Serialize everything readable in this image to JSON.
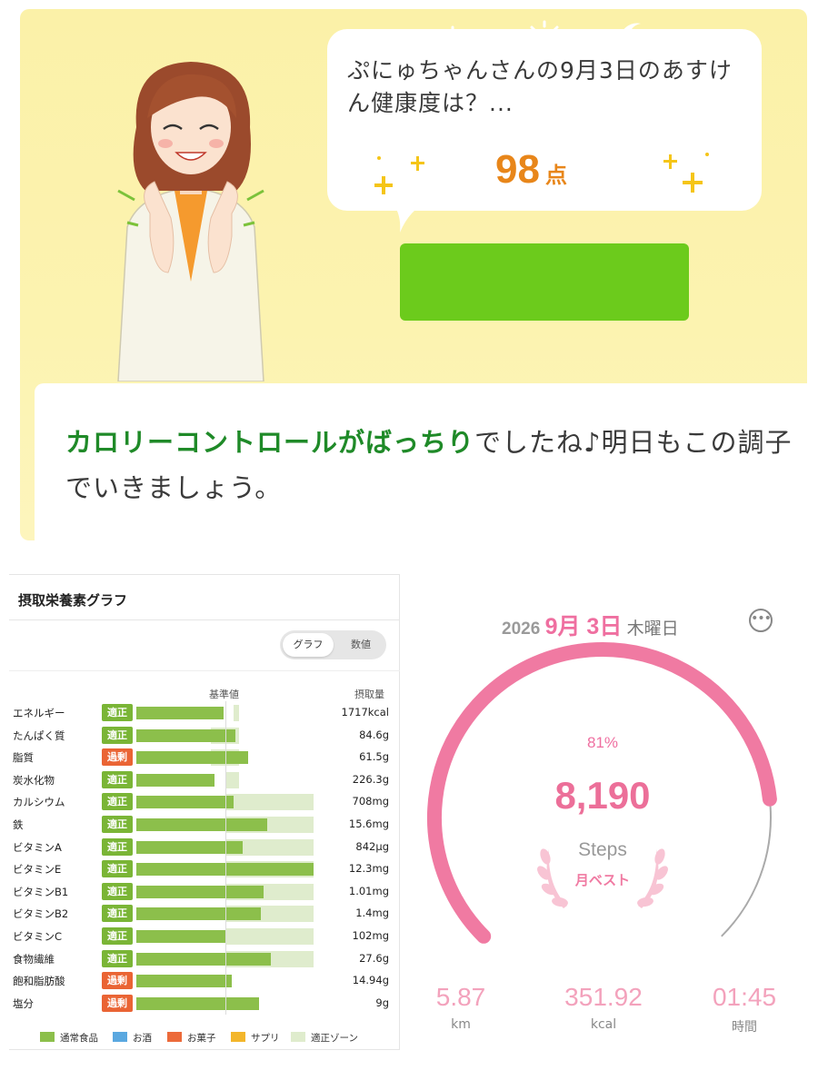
{
  "health": {
    "question": "ぷにゅちゃんさんの9月3日のあすけん健康度は？...",
    "score": "98",
    "score_unit": "点",
    "message_highlight": "カロリーコントロールがばっちり",
    "message_rest": "でしたね♪明日もこの調子でいきましょう。",
    "time_icons": [
      "sunrise-icon",
      "sun-icon",
      "moon-icon"
    ]
  },
  "nutrients": {
    "title": "摂取栄養素グラフ",
    "toggle": {
      "graph": "グラフ",
      "values": "数値"
    },
    "col_reference": "基準値",
    "col_intake": "摂取量",
    "rows": [
      {
        "name": "エネルギー",
        "status": "適正",
        "value": "1717kcal",
        "level": 0.49,
        "zone": [
          0.55,
          0.58
        ]
      },
      {
        "name": "たんぱく質",
        "status": "適正",
        "value": "84.6g",
        "level": 0.56,
        "zone": [
          0.42,
          0.58
        ]
      },
      {
        "name": "脂質",
        "status": "過剰",
        "value": "61.5g",
        "level": 0.63,
        "zone": [
          0.42,
          0.58
        ]
      },
      {
        "name": "炭水化物",
        "status": "適正",
        "value": "226.3g",
        "level": 0.44,
        "zone": [
          0.5,
          0.58
        ]
      },
      {
        "name": "カルシウム",
        "status": "適正",
        "value": "708mg",
        "level": 0.55,
        "zone": [
          0.5,
          1.0
        ]
      },
      {
        "name": "鉄",
        "status": "適正",
        "value": "15.6mg",
        "level": 0.74,
        "zone": [
          0.5,
          1.0
        ]
      },
      {
        "name": "ビタミンA",
        "status": "適正",
        "value": "842μg",
        "level": 0.6,
        "zone": [
          0.5,
          1.0
        ]
      },
      {
        "name": "ビタミンE",
        "status": "適正",
        "value": "12.3mg",
        "level": 1.0,
        "zone": [
          0.5,
          1.0
        ]
      },
      {
        "name": "ビタミンB1",
        "status": "適正",
        "value": "1.01mg",
        "level": 0.72,
        "zone": [
          0.5,
          1.0
        ]
      },
      {
        "name": "ビタミンB2",
        "status": "適正",
        "value": "1.4mg",
        "level": 0.7,
        "zone": [
          0.5,
          1.0
        ]
      },
      {
        "name": "ビタミンC",
        "status": "適正",
        "value": "102mg",
        "level": 0.51,
        "zone": [
          0.5,
          1.0
        ]
      },
      {
        "name": "食物繊維",
        "status": "適正",
        "value": "27.6g",
        "level": 0.76,
        "zone": [
          0.5,
          1.0
        ]
      },
      {
        "name": "飽和脂肪酸",
        "status": "過剰",
        "value": "14.94g",
        "level": 0.54,
        "zone": [
          0.5,
          0.5
        ]
      },
      {
        "name": "塩分",
        "status": "過剰",
        "value": "9g",
        "level": 0.69,
        "zone": [
          0.5,
          0.5
        ]
      }
    ],
    "legend": [
      {
        "label": "通常食品",
        "color": "#8cbf4b"
      },
      {
        "label": "お酒",
        "color": "#5aa8e0"
      },
      {
        "label": "お菓子",
        "color": "#ec6a3a"
      },
      {
        "label": "サプリ",
        "color": "#f3b62b"
      },
      {
        "label": "適正ゾーン",
        "color": "#dfeccd"
      }
    ],
    "status_colors": {
      "適正": "#7ab536",
      "過剰": "#ea6434"
    }
  },
  "steps": {
    "year": "2026",
    "date": "9月 3日",
    "weekday": "木曜日",
    "percent": "81%",
    "percent_value": 0.81,
    "count": "8,190",
    "label": "Steps",
    "badge": "月ベスト",
    "stats": [
      {
        "value": "5.87",
        "unit": "km"
      },
      {
        "value": "351.92",
        "unit": "kcal"
      },
      {
        "value": "01:45",
        "unit": "時間"
      }
    ],
    "accent": "#f07aa2"
  }
}
